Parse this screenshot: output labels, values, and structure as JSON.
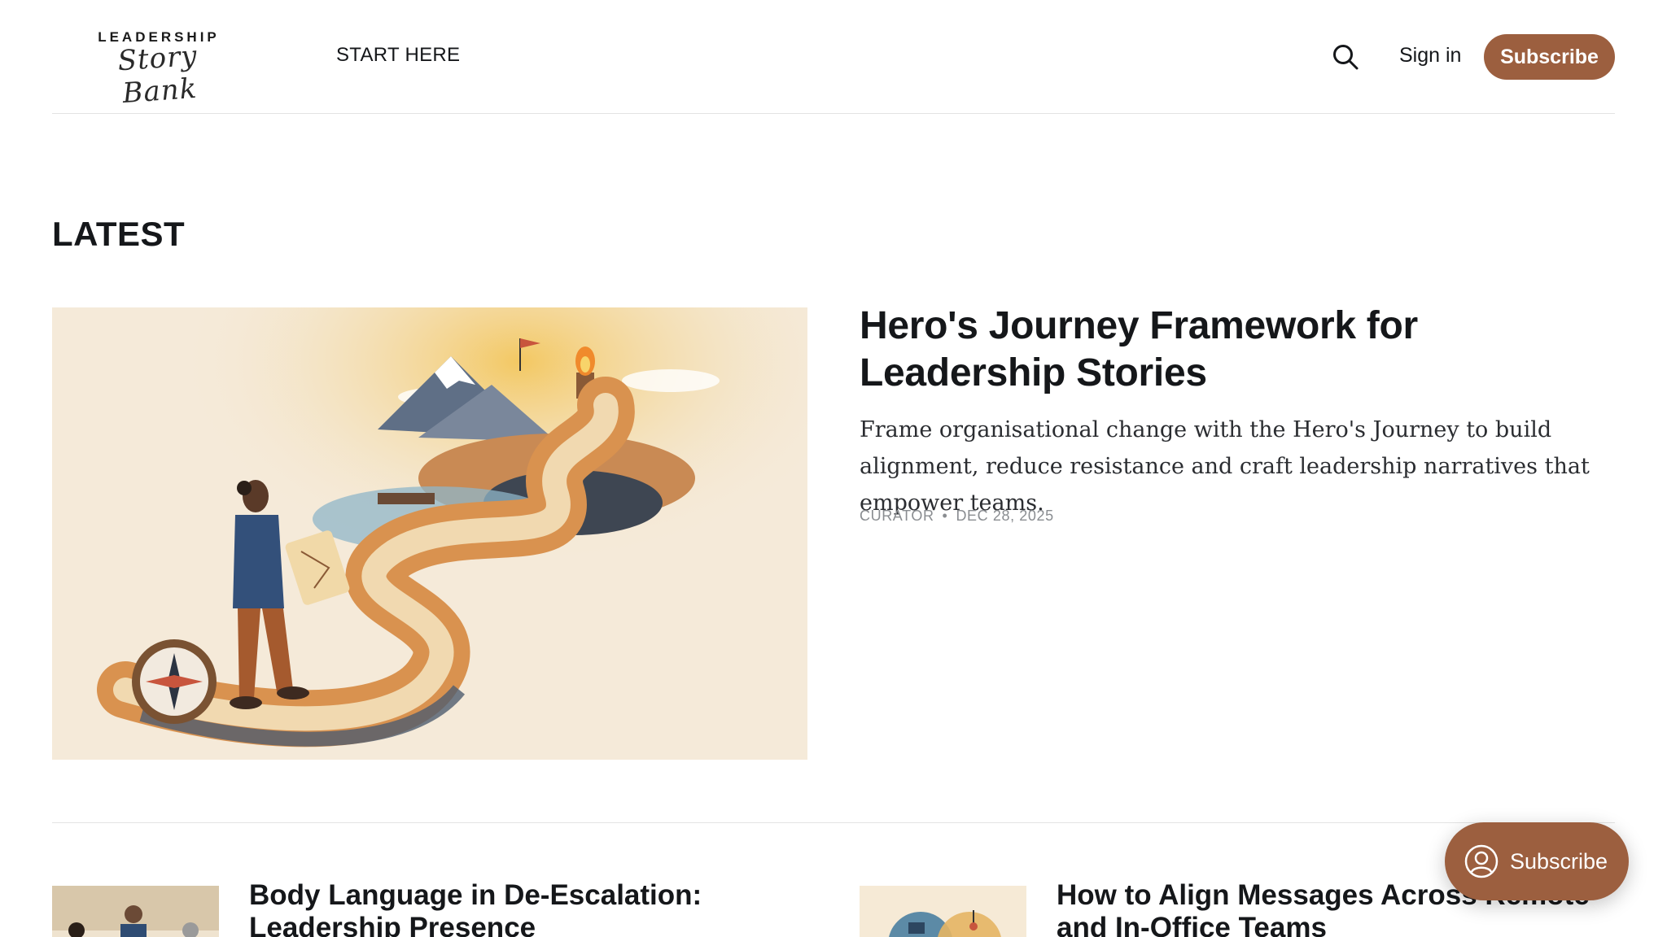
{
  "header": {
    "logo": {
      "top_text": "LEADERSHIP",
      "script_text": "Story Bank"
    },
    "nav": [
      {
        "label": "START HERE"
      }
    ],
    "search_icon": "search-icon",
    "signin_label": "Sign in",
    "subscribe_label": "Subscribe"
  },
  "latest": {
    "heading": "LATEST",
    "featured": {
      "title": "Hero's Journey Framework for Leadership Stories",
      "excerpt": "Frame organisational change with the Hero's Journey to build alignment, reduce resistance and craft leadership narratives that empower teams.",
      "author": "CURATOR",
      "separator": "•",
      "date": "DEC 28, 2025"
    },
    "posts": [
      {
        "title": "Body Language in De-Escalation: Leadership Presence"
      },
      {
        "title": "How to Align Messages Across Remote and In-Office Teams"
      }
    ]
  },
  "portal": {
    "label": "Subscribe",
    "icon": "user-circle-icon"
  },
  "colors": {
    "accent": "#9c5f3f",
    "text": "#15171a",
    "muted": "#8a8d91",
    "divider": "#e3e3e3"
  }
}
